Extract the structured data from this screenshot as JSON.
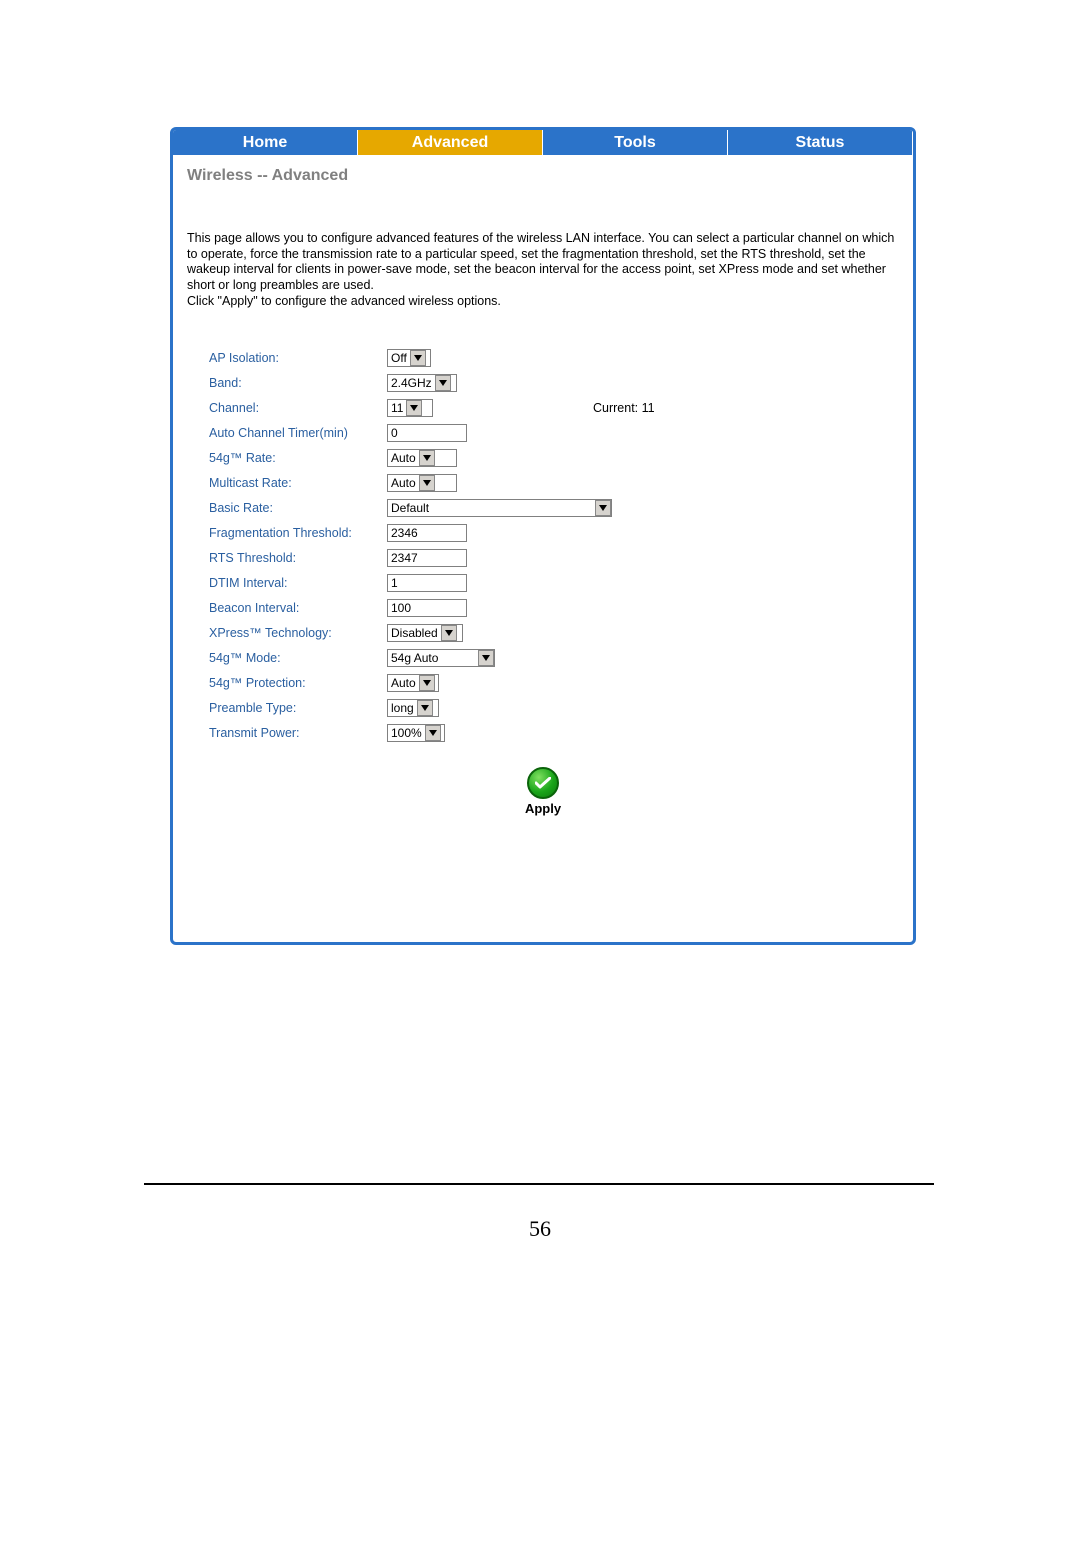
{
  "tabs": {
    "home": "Home",
    "advanced": "Advanced",
    "tools": "Tools",
    "status": "Status"
  },
  "heading": "Wireless -- Advanced",
  "description": {
    "p1": "This page allows you to configure advanced features of the wireless LAN interface. You can select a particular channel on which to operate, force the transmission rate to a particular speed, set the fragmentation threshold, set the RTS threshold, set the wakeup interval for clients in power-save mode, set the beacon interval for the access point, set XPress mode and set whether short or long preambles are used.",
    "p2": "Click \"Apply\" to configure the advanced wireless options."
  },
  "form": {
    "ap_isolation": {
      "label": "AP Isolation:",
      "value": "Off"
    },
    "band": {
      "label": "Band:",
      "value": "2.4GHz"
    },
    "channel": {
      "label": "Channel:",
      "value": "11",
      "current_label": "Current: 11"
    },
    "auto_channel_timer": {
      "label": "Auto Channel Timer(min)",
      "value": "0"
    },
    "g54_rate": {
      "label": "54g™ Rate:",
      "value": "Auto"
    },
    "multicast_rate": {
      "label": "Multicast Rate:",
      "value": "Auto"
    },
    "basic_rate": {
      "label": "Basic Rate:",
      "value": "Default"
    },
    "frag_threshold": {
      "label": "Fragmentation Threshold:",
      "value": "2346"
    },
    "rts_threshold": {
      "label": "RTS Threshold:",
      "value": "2347"
    },
    "dtim_interval": {
      "label": "DTIM Interval:",
      "value": "1"
    },
    "beacon_interval": {
      "label": "Beacon Interval:",
      "value": "100"
    },
    "xpress": {
      "label": "XPress™ Technology:",
      "value": "Disabled"
    },
    "g54_mode": {
      "label": "54g™ Mode:",
      "value": "54g Auto"
    },
    "g54_protection": {
      "label": "54g™ Protection:",
      "value": "Auto"
    },
    "preamble": {
      "label": "Preamble Type:",
      "value": "long"
    },
    "tx_power": {
      "label": "Transmit Power:",
      "value": "100%"
    }
  },
  "apply_label": "Apply",
  "page_number": "56"
}
